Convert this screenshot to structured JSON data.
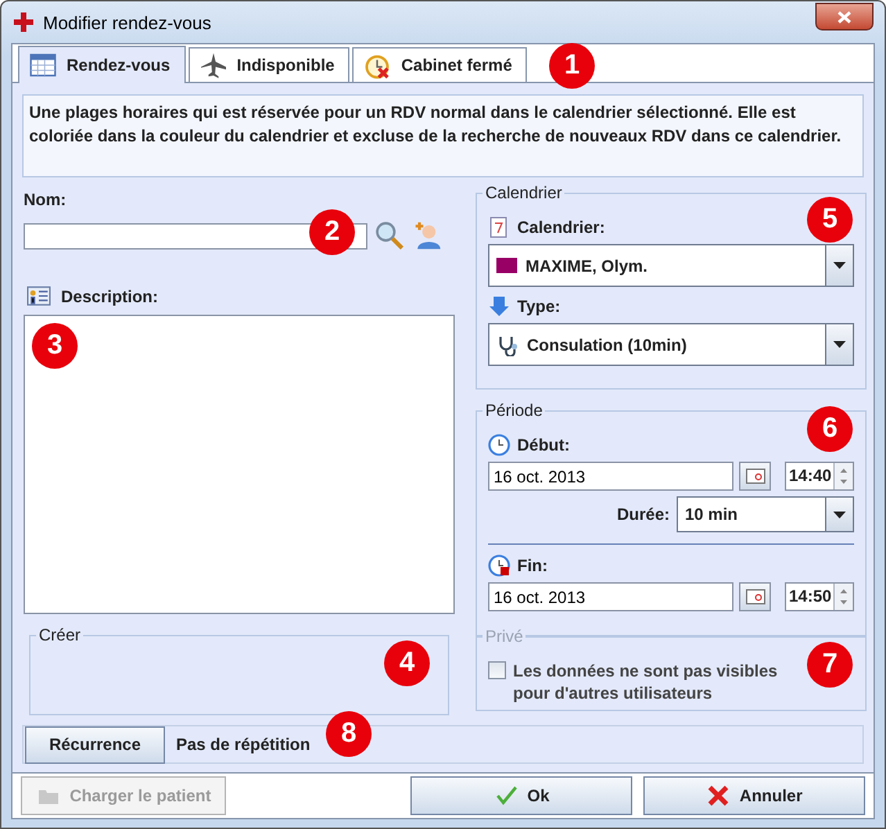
{
  "window": {
    "title": "Modifier rendez-vous"
  },
  "tabs": [
    {
      "label": "Rendez-vous",
      "selected": true,
      "kind": "calendar"
    },
    {
      "label": "Indisponible",
      "selected": false,
      "kind": "plane"
    },
    {
      "label": "Cabinet fermé",
      "selected": false,
      "kind": "alarm"
    }
  ],
  "info_text": "Une plages horaires qui est réservée pour un RDV normal dans le calendrier sélectionné. Elle est coloriée dans la couleur du calendrier et excluse de la recherche de nouveaux RDV dans ce calendrier.",
  "nom": {
    "label": "Nom:"
  },
  "description": {
    "label": "Description:"
  },
  "creer": {
    "title": "Créer"
  },
  "calendrier": {
    "title": "Calendrier",
    "calendar_label": "Calendrier:",
    "calendar_value": "MAXIME, Olym.",
    "color": "#990066",
    "type_label": "Type:",
    "type_value": "Consulation  (10min)"
  },
  "periode": {
    "title": "Période",
    "debut_label": "Début:",
    "debut_date": "16 oct. 2013",
    "debut_time": "14:40",
    "duree_label": "Durée:",
    "duree_value": "10 min",
    "fin_label": "Fin:",
    "fin_date": "16 oct. 2013",
    "fin_time": "14:50"
  },
  "prive": {
    "title": "Privé",
    "disabled": true,
    "checkbox_label": "Les données ne sont pas visibles pour d'autres utilisateurs",
    "checked": false
  },
  "recurrence": {
    "button": "Récurrence",
    "status": "Pas de répétition"
  },
  "buttons": [
    {
      "label": "Charger le patient",
      "kind": "load",
      "disabled": true
    },
    {
      "label": "Ok",
      "kind": "ok",
      "disabled": false
    },
    {
      "label": "Annuler",
      "kind": "cancel",
      "disabled": false
    }
  ],
  "callouts": [
    "1",
    "2",
    "3",
    "4",
    "5",
    "6",
    "7",
    "8"
  ]
}
